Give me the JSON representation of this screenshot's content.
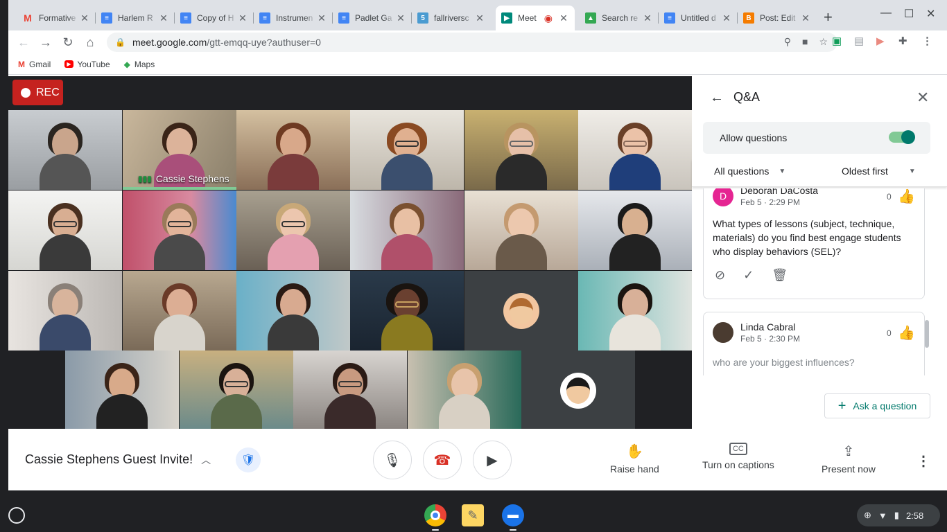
{
  "browser": {
    "tabs": [
      {
        "title": "Formative",
        "favicon": "gmail-icon",
        "color": "#ea4335"
      },
      {
        "title": "Harlem R",
        "favicon": "docs-icon",
        "color": "#4285f4"
      },
      {
        "title": "Copy of H",
        "favicon": "docs-icon",
        "color": "#4285f4"
      },
      {
        "title": "Instrumen",
        "favicon": "docs-icon",
        "color": "#4285f4"
      },
      {
        "title": "Padlet Ga",
        "favicon": "docs-icon",
        "color": "#4285f4"
      },
      {
        "title": "fallriversc",
        "favicon": "site-icon",
        "color": "#4a9bd1"
      },
      {
        "title": "Meet",
        "favicon": "meet-icon",
        "color": "#00897b",
        "active": true
      },
      {
        "title": "Search re",
        "favicon": "drive-icon",
        "color": "#fbbc04"
      },
      {
        "title": "Untitled d",
        "favicon": "docs-icon",
        "color": "#4285f4"
      },
      {
        "title": "Post: Edit",
        "favicon": "blogger-icon",
        "color": "#f57c00"
      }
    ],
    "url_host": "meet.google.com",
    "url_path": "/gtt-emqq-uye?authuser=0",
    "bookmarks": [
      {
        "label": "Gmail",
        "icon": "gmail-icon"
      },
      {
        "label": "YouTube",
        "icon": "youtube-icon"
      },
      {
        "label": "Maps",
        "icon": "maps-icon"
      }
    ]
  },
  "meet": {
    "rec_label": "REC",
    "active_speaker": "Cassie Stephens",
    "meeting_title": "Cassie Stephens Guest Invite!",
    "controls": {
      "raise_hand": "Raise hand",
      "captions": "Turn on captions",
      "present": "Present now"
    },
    "qa": {
      "title": "Q&A",
      "allow_questions": "Allow questions",
      "allow_enabled": true,
      "filter_all": "All questions",
      "filter_order": "Oldest first",
      "questions": [
        {
          "author": "Deborah DaCosta",
          "initial": "D",
          "avatar_color": "#e52592",
          "time": "Feb 5 · 2:29 PM",
          "likes": "0",
          "text": "What types of lessons (subject, technique, materials) do you find best engage students who display behaviors (SEL)?"
        },
        {
          "author": "Linda Cabral",
          "initial": "",
          "avatar_color": "#4a3b30",
          "time": "Feb 5 · 2:30 PM",
          "likes": "0",
          "text": "who are your biggest influences?"
        }
      ],
      "ask_button": "Ask a question"
    }
  },
  "shelf": {
    "time": "2:58"
  },
  "colors": {
    "accent": "#00796b",
    "record_red": "#c5221f",
    "hangup_red": "#d93025"
  }
}
